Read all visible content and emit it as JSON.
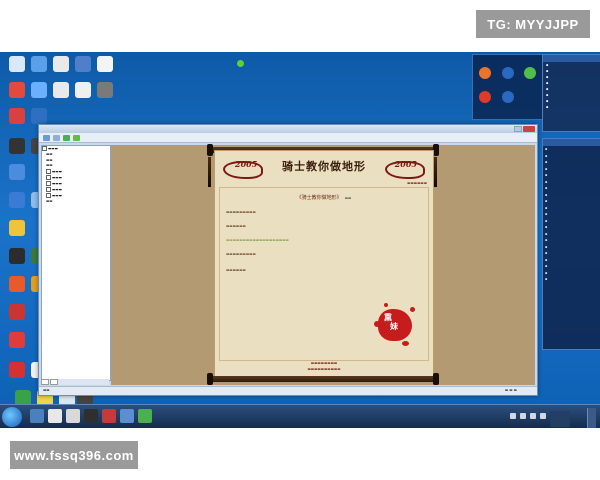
{
  "watermarks": {
    "top": "TG: MYYJJPP",
    "bottom": "www.fssq396.com"
  },
  "scroll": {
    "title": "骑士教你做地形",
    "year_left": "2005",
    "year_right": "2005",
    "heading": "《骑士教你做地形》",
    "stamp_lines": [
      "熏",
      "妹"
    ]
  },
  "colors": {
    "desktop": "#1b73c9",
    "stamp": "#c71c1c",
    "scroll_paper": "#ebdfc1",
    "content_bg": "#b49a72"
  },
  "icons": [
    "recycle-bin-icon",
    "computer-icon",
    "browser-icon",
    "folder-icon",
    "game-icon",
    "chat-icon",
    "media-player-icon",
    "network-icon",
    "antivirus-icon",
    "music-icon",
    "document-icon",
    "settings-icon"
  ]
}
